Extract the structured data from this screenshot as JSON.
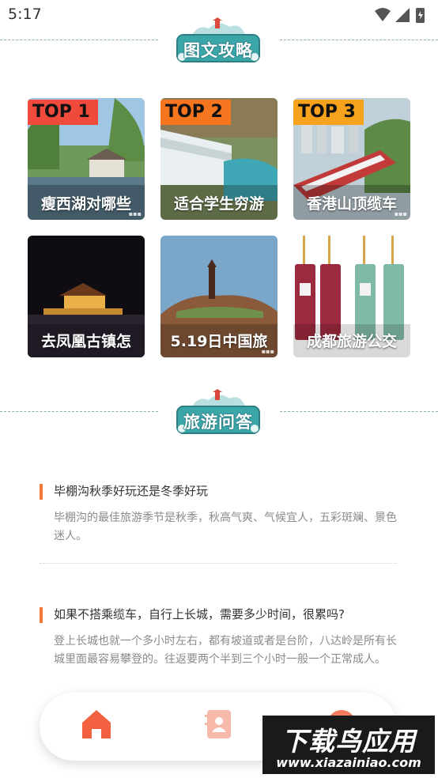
{
  "status_bar": {
    "time": "5:17"
  },
  "sections": {
    "guides_title": "图文攻略",
    "qa_title": "旅游问答"
  },
  "guides": [
    {
      "rank": "TOP 1",
      "title": "瘦西湖对哪些",
      "rank_color": "#f04a3c"
    },
    {
      "rank": "TOP 2",
      "title": "适合学生穷游",
      "rank_color": "#f5761f"
    },
    {
      "rank": "TOP 3",
      "title": "香港山顶缆车",
      "rank_color": "#f7a21d"
    },
    {
      "rank": "",
      "title": "去凤凰古镇怎"
    },
    {
      "rank": "",
      "title": "5.19日中国旅"
    },
    {
      "rank": "",
      "title": "成都旅游公交"
    }
  ],
  "qa": [
    {
      "question": "毕棚沟秋季好玩还是冬季好玩",
      "answer": "毕棚沟的最佳旅游季节是秋季，秋高气爽、气候宜人，五彩斑斓、景色迷人。"
    },
    {
      "question": "如果不搭乘缆车，自行上长城，需要多少时间，很累吗?",
      "answer": "登上长城也就一个多小时左右，都有坡道或者是台阶，八达岭是所有长城里面最容易攀登的。往返要两个半到三个小时一般一个正常成人。"
    }
  ],
  "nav": {
    "items": [
      {
        "icon": "home-icon",
        "active": true
      },
      {
        "icon": "contact-card-icon",
        "active": false
      },
      {
        "icon": "profile-icon",
        "active": false
      }
    ]
  },
  "watermark": {
    "big": "下载鸟应用",
    "small": "www.xiazainiao.com"
  },
  "colors": {
    "accent": "#f07a3a",
    "teal": "#3aa6a8",
    "muted_text": "#8a8a8a"
  }
}
